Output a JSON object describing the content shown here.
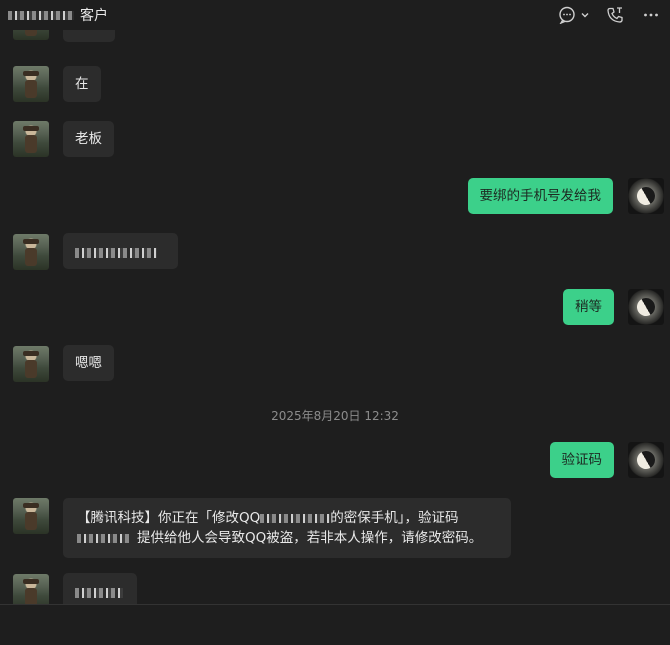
{
  "header": {
    "title_suffix": "客户",
    "icons": [
      "chat-bubble-icon",
      "chevron-down-icon",
      "phone-icon",
      "more-icon"
    ]
  },
  "messages": {
    "m1": "在",
    "m2": "老板",
    "m3": "要绑的手机号发给我",
    "m5": "稍等",
    "m6": "嗯嗯",
    "timestamp": "2025年8月20日 12:32",
    "m7": "验证码",
    "m8_part1": "【腾讯科技】你正在「修改QQ",
    "m8_part2": "的密保手机」，验证码",
    "m8_part3": "提供给他人会导致QQ被盗，若非本人操作，请修改密码。"
  },
  "colors": {
    "accent": "#3cd08a",
    "background": "#1e1e1e",
    "bubble_in": "#2c2c2c"
  }
}
